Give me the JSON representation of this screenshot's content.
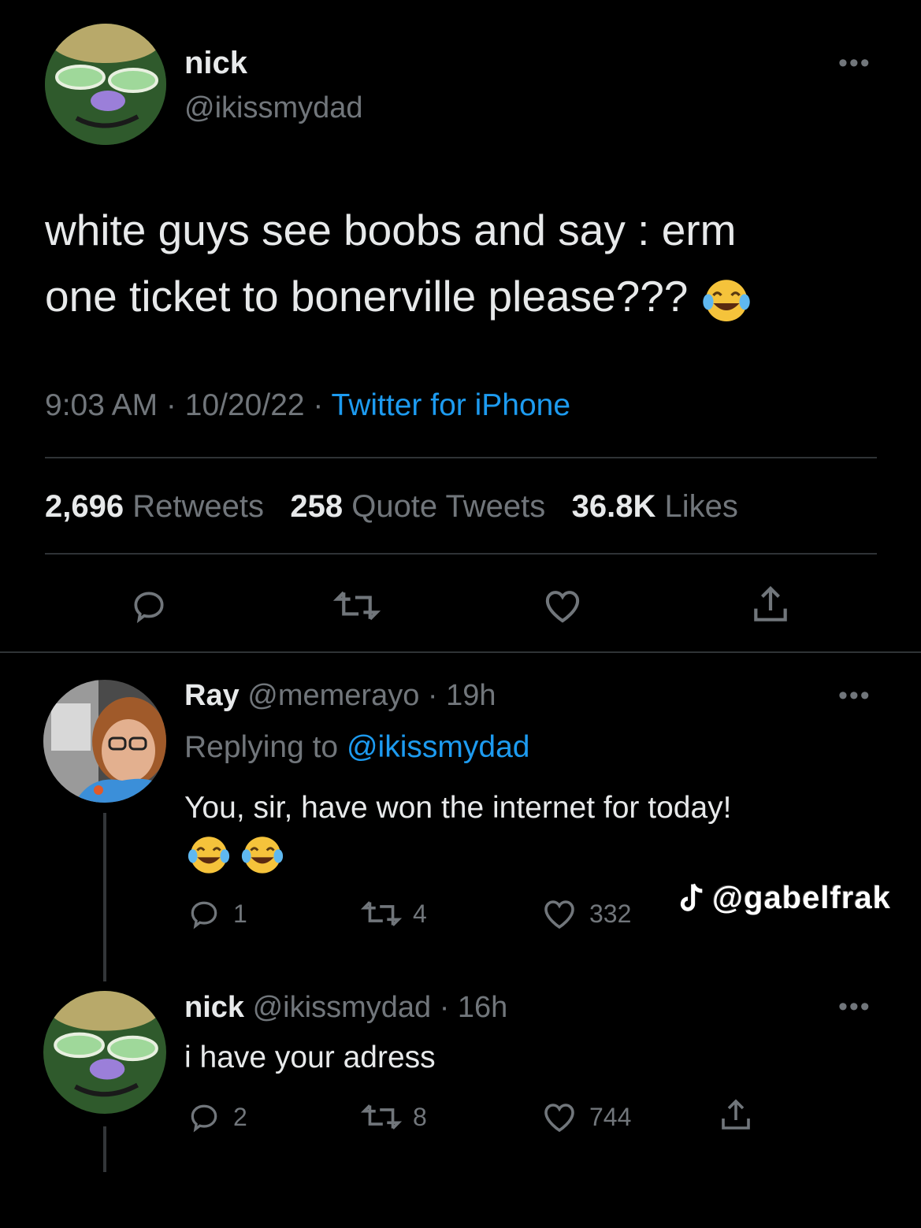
{
  "main_tweet": {
    "name": "nick",
    "handle": "@ikissmydad",
    "text_line1": "white guys see boobs and say : erm",
    "text_line2": "one ticket to bonerville please???",
    "time": "9:03 AM",
    "date": "10/20/22",
    "source": "Twitter for iPhone",
    "separator": " · ",
    "retweets_count": "2,696",
    "retweets_label": "Retweets",
    "quotes_count": "258",
    "quotes_label": "Quote Tweets",
    "likes_count": "36.8K",
    "likes_label": "Likes",
    "more": "•••"
  },
  "reply1": {
    "name": "Ray",
    "handle": "@memerayo",
    "age": "· 19h",
    "replying_prefix": "Replying to",
    "replying_to": "@ikissmydad",
    "text": "You, sir, have won the internet for today!",
    "replies": "1",
    "retweets": "4",
    "likes": "332",
    "more": "•••"
  },
  "reply2": {
    "name": "nick",
    "handle": "@ikissmydad",
    "age": "· 16h",
    "text": "i have your adress",
    "replies": "2",
    "retweets": "8",
    "likes": "744",
    "more": "•••"
  },
  "watermark": "@gabelfrak",
  "colors": {
    "background": "#000000",
    "text": "#e7e9ea",
    "secondary": "#71767b",
    "accent": "#1d9bf0",
    "divider": "#2f3336"
  },
  "icons": [
    "reply-icon",
    "retweet-icon",
    "like-icon",
    "share-icon",
    "laughing-emoji",
    "tiktok-icon"
  ]
}
